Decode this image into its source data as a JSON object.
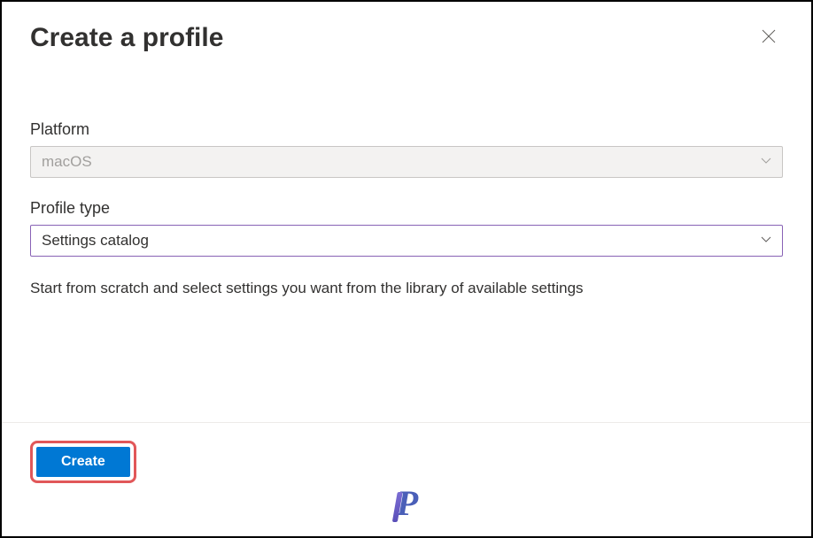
{
  "dialog": {
    "title": "Create a profile",
    "platform_label": "Platform",
    "platform_value": "macOS",
    "profile_type_label": "Profile type",
    "profile_type_value": "Settings catalog",
    "description": "Start from scratch and select settings you want from the library of available settings",
    "create_label": "Create"
  }
}
